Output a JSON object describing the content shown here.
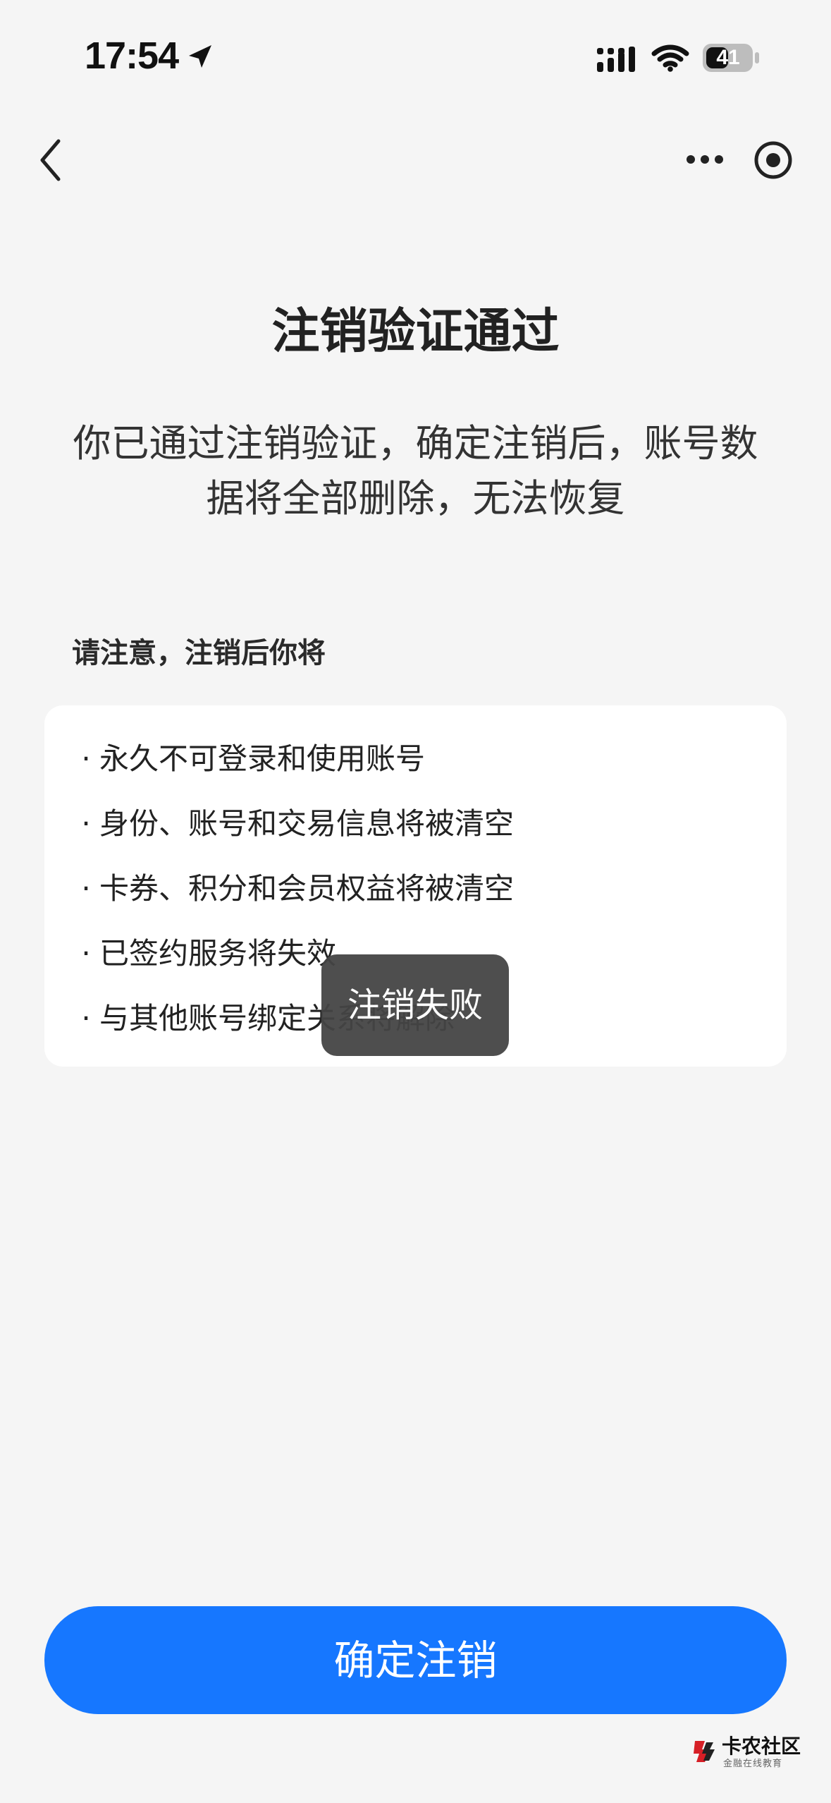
{
  "status_bar": {
    "time": "17:54",
    "battery": "41",
    "icons": {
      "location": "location-arrow-icon",
      "signal": "cellular-signal-icon",
      "wifi": "wifi-icon",
      "battery": "battery-icon"
    }
  },
  "nav": {
    "back_icon": "chevron-left-icon",
    "more_icon": "more-dots-icon",
    "record_icon": "target-circle-icon"
  },
  "main": {
    "title": "注销验证通过",
    "description": "你已通过注销验证，确定注销后，账号数据将全部删除，无法恢复",
    "section_label": "请注意，注销后你将",
    "notices": [
      "永久不可登录和使用账号",
      "身份、账号和交易信息将被清空",
      "卡券、积分和会员权益将被清空",
      "已签约服务将失效",
      "与其他账号绑定关系将解除"
    ]
  },
  "toast": {
    "text": "注销失败"
  },
  "actions": {
    "confirm_label": "确定注销"
  },
  "watermark": {
    "title": "卡农社区",
    "subtitle": "金融在线教育"
  },
  "colors": {
    "background": "#f5f5f5",
    "card": "#ffffff",
    "primary": "#1677ff",
    "toast": "#444444",
    "text": "#1f1f1f"
  }
}
